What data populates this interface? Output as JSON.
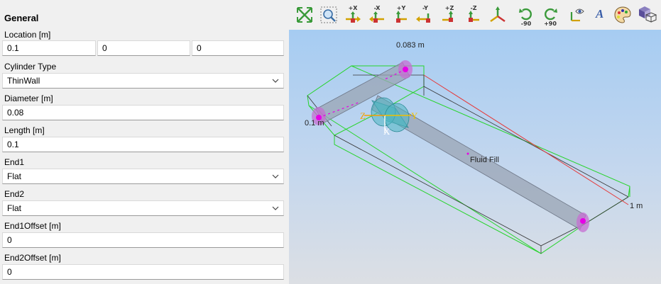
{
  "panel": {
    "title": "General",
    "location": {
      "label": "Location [m]",
      "x": "0.1",
      "y": "0",
      "z": "0"
    },
    "cylinder_type": {
      "label": "Cylinder Type",
      "value": "ThinWall"
    },
    "diameter": {
      "label": "Diameter [m]",
      "value": "0.08"
    },
    "length": {
      "label": "Length [m]",
      "value": "0.1"
    },
    "end1": {
      "label": "End1",
      "value": "Flat"
    },
    "end2": {
      "label": "End2",
      "value": "Flat"
    },
    "end1_offset": {
      "label": "End1Offset [m]",
      "value": "0"
    },
    "end2_offset": {
      "label": "End2Offset [m]",
      "value": "0"
    }
  },
  "toolbar": {
    "buttons": [
      {
        "name": "fit-all",
        "caption": ""
      },
      {
        "name": "zoom-window",
        "caption": ""
      },
      {
        "name": "view-plus-x",
        "caption": "+X"
      },
      {
        "name": "view-minus-x",
        "caption": "-X"
      },
      {
        "name": "view-plus-y",
        "caption": "+Y"
      },
      {
        "name": "view-minus-y",
        "caption": "-Y"
      },
      {
        "name": "view-plus-z",
        "caption": "+Z"
      },
      {
        "name": "view-minus-z",
        "caption": "-Z"
      },
      {
        "name": "isometric",
        "caption": ""
      },
      {
        "name": "rotate-minus-90",
        "caption": "-90"
      },
      {
        "name": "rotate-plus-90",
        "caption": "+90"
      },
      {
        "name": "show-axes",
        "caption": ""
      },
      {
        "name": "annotation-text",
        "caption": "A"
      },
      {
        "name": "appearance",
        "caption": ""
      },
      {
        "name": "projection",
        "caption": ""
      }
    ]
  },
  "viewport": {
    "dim_top": "0.083 m",
    "dim_left": "0.1 m",
    "dim_right": "1 m",
    "fluid_label": "Fluid Fill",
    "axis_x": "X",
    "axis_y": "Y",
    "axis_z": "Z",
    "colors": {
      "bbox": "#27d42b",
      "red_line": "#e53a3a",
      "endpoint": "#e600e6",
      "cylinder": "#9aa4b4",
      "selected": "#4fb6c2"
    }
  }
}
